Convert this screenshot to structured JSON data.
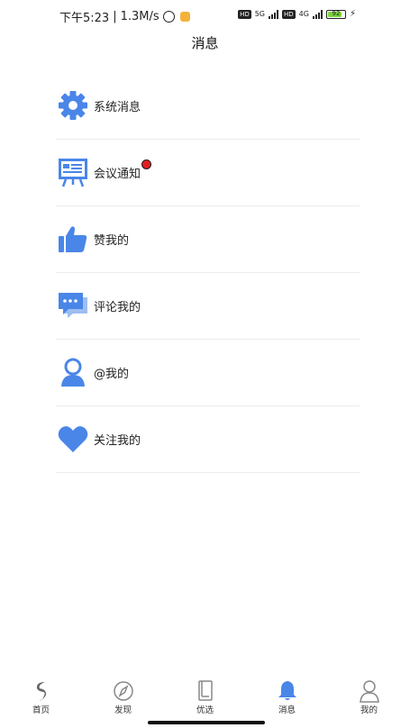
{
  "status_bar": {
    "time": "下午5:23",
    "speed": "1.3M/s",
    "network1": "5G",
    "network2": "4G",
    "hd_label": "HD",
    "battery": "92"
  },
  "header": {
    "title": "消息"
  },
  "items": [
    {
      "label": "系统消息",
      "icon": "gear-icon",
      "badge": false
    },
    {
      "label": "会议通知",
      "icon": "presentation-icon",
      "badge": true
    },
    {
      "label": "赞我的",
      "icon": "thumbs-up-icon",
      "badge": false
    },
    {
      "label": "评论我的",
      "icon": "comment-icon",
      "badge": false
    },
    {
      "label": "@我的",
      "icon": "user-icon",
      "badge": false
    },
    {
      "label": "关注我的",
      "icon": "heart-icon",
      "badge": false
    }
  ],
  "tabs": [
    {
      "label": "首页",
      "icon": "home-logo-icon",
      "active": false
    },
    {
      "label": "发现",
      "icon": "compass-icon",
      "active": false
    },
    {
      "label": "优选",
      "icon": "book-icon",
      "active": false
    },
    {
      "label": "消息",
      "icon": "bell-icon",
      "active": true
    },
    {
      "label": "我的",
      "icon": "profile-icon",
      "active": false
    }
  ],
  "colors": {
    "accent": "#4a86e8",
    "badge": "#e02020",
    "divider": "#ececec"
  }
}
